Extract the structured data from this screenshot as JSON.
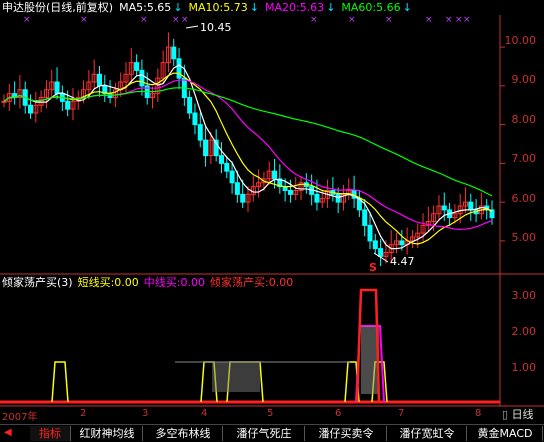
{
  "stock": {
    "name": "申达股份(日线,前复权)",
    "ma5": "MA5:5.65",
    "ma10": "MA10:5.73",
    "ma20": "MA20:5.63",
    "ma60": "MA60:5.66",
    "high_label": "10.45",
    "low_label": "4.47",
    "signal_mark": "S"
  },
  "price_axis": [
    "10.00",
    "9.00",
    "8.00",
    "7.00",
    "6.00",
    "5.00"
  ],
  "indicator": {
    "name": "倾家荡产买(3)",
    "short": "短线买:0.00",
    "mid": "中线买:0.00",
    "all": "倾家荡产买:0.00",
    "axis": [
      "3.00",
      "2.00",
      "1.00"
    ]
  },
  "date_axis": {
    "ticks": [
      "2007年",
      "2",
      "3",
      "4",
      "5",
      "6",
      "7",
      "8"
    ],
    "period": "日线"
  },
  "tabs": [
    "指标",
    "红财神均线",
    "多空布林线",
    "潘仔气死庄",
    "潘仔买卖令",
    "潘仔宽虹令",
    "黄金MACD"
  ],
  "colors": {
    "ma5": "#ffffff",
    "ma10": "#ffff00",
    "ma20": "#ff00ff",
    "ma60": "#00ff00",
    "up": "#ff3030",
    "down": "#00ffff",
    "axis": "#c83232"
  },
  "chart_data": {
    "type": "candlestick",
    "title": "申达股份(日线,前复权)",
    "high": 10.45,
    "low": 4.47,
    "ylim": [
      4.3,
      10.7
    ],
    "close": [
      8.6,
      8.8,
      8.7,
      8.9,
      8.5,
      8.3,
      8.5,
      8.7,
      8.9,
      9.1,
      8.8,
      8.6,
      8.4,
      8.6,
      8.7,
      8.9,
      9.1,
      9.3,
      9.0,
      8.8,
      8.7,
      8.9,
      9.1,
      9.3,
      9.6,
      9.4,
      9.0,
      8.7,
      8.8,
      9.2,
      9.6,
      10.0,
      9.7,
      9.2,
      8.7,
      8.3,
      8.0,
      7.6,
      7.2,
      7.6,
      7.2,
      7.0,
      6.8,
      6.5,
      6.2,
      6.0,
      6.2,
      6.4,
      6.5,
      6.6,
      6.8,
      6.6,
      6.4,
      6.3,
      6.2,
      6.3,
      6.5,
      6.4,
      6.2,
      6.0,
      6.1,
      6.3,
      6.2,
      6.0,
      6.2,
      6.3,
      6.1,
      5.8,
      5.4,
      5.0,
      4.8,
      4.6,
      4.7,
      4.9,
      5.0,
      4.9,
      5.0,
      5.1,
      5.2,
      5.4,
      5.5,
      5.7,
      5.9,
      5.8,
      5.6,
      5.7,
      5.9,
      6.0,
      5.8,
      5.7,
      5.9,
      5.8,
      5.6
    ]
  }
}
